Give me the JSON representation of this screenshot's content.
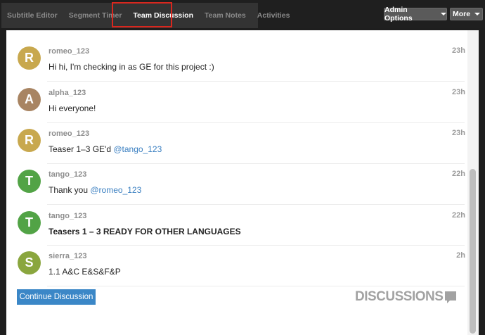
{
  "tabs": [
    {
      "label": "Subtitle Editor"
    },
    {
      "label": "Segment Timer"
    },
    {
      "label": "Team Discussion"
    },
    {
      "label": "Team Notes"
    },
    {
      "label": "Activities"
    }
  ],
  "toolbar": {
    "admin_label": "Admin Options",
    "more_label": "More"
  },
  "messages": [
    {
      "initial": "R",
      "user": "romeo_123",
      "time": "23h",
      "text": "Hi hi, I'm checking in as GE for this project :)",
      "avatar_color": "#c8a84e"
    },
    {
      "initial": "A",
      "user": "alpha_123",
      "time": "23h",
      "text": "Hi everyone!",
      "avatar_color": "#a88462"
    },
    {
      "initial": "R",
      "user": "romeo_123",
      "time": "23h",
      "text": "Teaser 1–3 GE'd ",
      "mention": "@tango_123",
      "avatar_color": "#c8a84e"
    },
    {
      "initial": "T",
      "user": "tango_123",
      "time": "22h",
      "text": "Thank you ",
      "mention": "@romeo_123",
      "avatar_color": "#52a346"
    },
    {
      "initial": "T",
      "user": "tango_123",
      "time": "22h",
      "text": "Teasers 1 – 3 READY FOR OTHER LANGUAGES",
      "avatar_color": "#52a346"
    },
    {
      "initial": "S",
      "user": "sierra_123",
      "time": "2h",
      "text": "1.1 A&C E&S&F&P",
      "avatar_color": "#8aa63e"
    }
  ],
  "footer": {
    "continue_label": "Continue Discussion",
    "logo_text": "DISCUSSIONS"
  }
}
